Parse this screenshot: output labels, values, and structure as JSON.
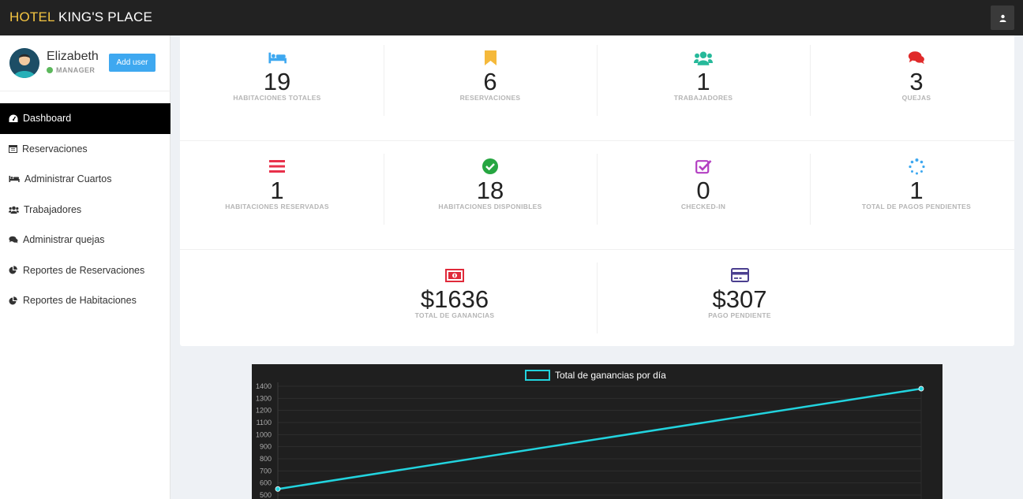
{
  "header": {
    "brand_highlight": "HOTEL",
    "brand_rest": " KING'S PLACE"
  },
  "profile": {
    "name": "Elizabeth",
    "role": "MANAGER",
    "add_user_label": "Add user"
  },
  "menu": [
    {
      "label": "Dashboard",
      "icon": "dashboard-icon"
    },
    {
      "label": "Reservaciones",
      "icon": "calendar-icon"
    },
    {
      "label": "Administrar Cuartos",
      "icon": "bed-icon"
    },
    {
      "label": "Trabajadores",
      "icon": "users-icon"
    },
    {
      "label": "Administrar quejas",
      "icon": "comments-icon"
    },
    {
      "label": "Reportes de Reservaciones",
      "icon": "pie-chart-icon"
    },
    {
      "label": "Reportes de Habitaciones",
      "icon": "pie-chart-icon"
    }
  ],
  "stats": [
    {
      "value": "19",
      "label": "HABITACIONES TOTALES",
      "icon": "bed-icon",
      "color": "#3ea8f0"
    },
    {
      "value": "6",
      "label": "RESERVACIONES",
      "icon": "bookmark-icon",
      "color": "#f5b93b"
    },
    {
      "value": "1",
      "label": "TRABAJADORES",
      "icon": "users-icon",
      "color": "#26b99a"
    },
    {
      "value": "3",
      "label": "QUEJAS",
      "icon": "comments-icon",
      "color": "#e02a2a"
    },
    {
      "value": "1",
      "label": "HABITACIONES RESERVADAS",
      "icon": "list-icon",
      "color": "#e8304a"
    },
    {
      "value": "18",
      "label": "HABITACIONES DISPONIBLES",
      "icon": "check-circle-icon",
      "color": "#26a641"
    },
    {
      "value": "0",
      "label": "CHECKED-IN",
      "icon": "check-square-icon",
      "color": "#b33fc2"
    },
    {
      "value": "1",
      "label": "TOTAL DE PAGOS PENDIENTES",
      "icon": "spinner-icon",
      "color": "#3ea8f0"
    },
    {
      "value": "$1636",
      "label": "TOTAL DE GANANCIAS",
      "icon": "money-icon",
      "color": "#e02a3a"
    },
    {
      "value": "$307",
      "label": "PAGO PENDIENTE",
      "icon": "credit-card-icon",
      "color": "#4b3f8f"
    }
  ],
  "chart_data": {
    "type": "line",
    "series": [
      {
        "name": "Total de ganancias por día",
        "values": [
          550,
          1380
        ],
        "color": "#22d3de"
      }
    ],
    "x": [
      0,
      1
    ],
    "yticks": [
      1400,
      1300,
      1200,
      1100,
      1000,
      900,
      800,
      700,
      600,
      500
    ],
    "ylim": [
      500,
      1400
    ],
    "grid": true,
    "legend": "top"
  }
}
